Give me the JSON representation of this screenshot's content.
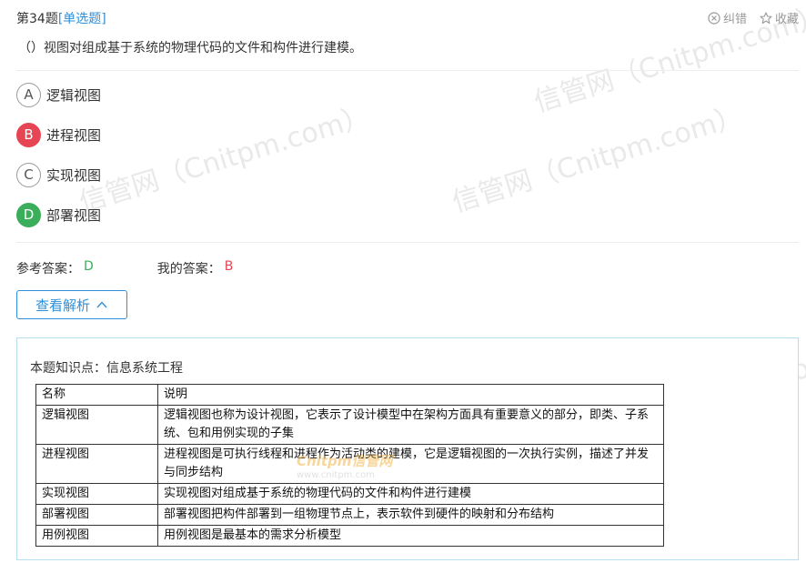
{
  "question": {
    "number": "第34题",
    "type": "[单选题]",
    "text": "（）视图对组成基于系统的物理代码的文件和构件进行建模。"
  },
  "actions": {
    "correct_error": "纠错",
    "favorite": "收藏"
  },
  "options": [
    {
      "letter": "A",
      "label": "逻辑视图",
      "state": "normal"
    },
    {
      "letter": "B",
      "label": "进程视图",
      "state": "wrong"
    },
    {
      "letter": "C",
      "label": "实现视图",
      "state": "normal"
    },
    {
      "letter": "D",
      "label": "部署视图",
      "state": "right"
    }
  ],
  "answers": {
    "ref_label": "参考答案：",
    "ref_value": "D",
    "mine_label": "我的答案：",
    "mine_value": "B"
  },
  "analysis_button": "查看解析",
  "knowledge": {
    "label": "本题知识点：",
    "value": "信息系统工程"
  },
  "table": {
    "headers": [
      "名称",
      "说明"
    ],
    "rows": [
      [
        "逻辑视图",
        "逻辑视图也称为设计视图，它表示了设计模型中在架构方面具有重要意义的部分，即类、子系统、包和用例实现的子集"
      ],
      [
        "进程视图",
        "进程视图是可执行线程和进程作为活动类的建模，它是逻辑视图的一次执行实例，描述了并发与同步结构"
      ],
      [
        "实现视图",
        "实现视图对组成基于系统的物理代码的文件和构件进行建模"
      ],
      [
        "部署视图",
        "部署视图把构件部署到一组物理节点上，表示软件到硬件的映射和分布结构"
      ],
      [
        "用例视图",
        "用例视图是最基本的需求分析模型"
      ]
    ]
  },
  "watermark": {
    "text": "信管网（Cnitpm.com）",
    "logo": "Cnitpm信管网",
    "logo_url": "www.cnitpm.com"
  },
  "colors": {
    "accent": "#2f8fd8",
    "correct": "#3aae5b",
    "wrong": "#e64554",
    "box_border": "#b8dff0"
  }
}
